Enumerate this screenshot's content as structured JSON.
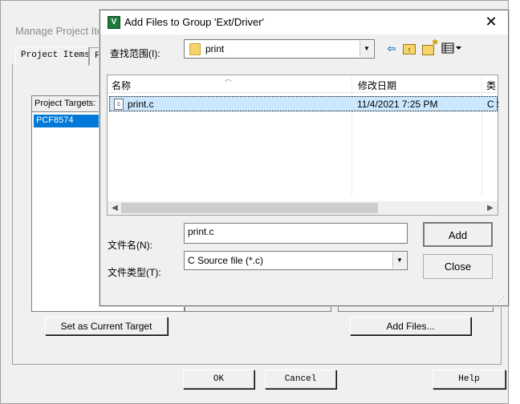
{
  "background_dialog": {
    "title": "Manage Project Ite",
    "tabs": [
      "Project Items",
      "Fo"
    ],
    "targets_header": "Project Targets:",
    "targets": [
      "PCF8574"
    ],
    "set_current_target_label": "Set as Current Target",
    "add_files_label": "Add Files...",
    "ok_label": "OK",
    "cancel_label": "Cancel",
    "help_label": "Help"
  },
  "add_files_dialog": {
    "title": "Add Files to Group 'Ext/Driver'",
    "app_icon": "V",
    "close_glyph": "✕",
    "lookin_label": "查找范围(I):",
    "lookin_value": "print",
    "toolbar_icons": [
      "back-icon",
      "up-folder-icon",
      "new-folder-icon",
      "view-menu-icon"
    ],
    "columns": {
      "name": "名称",
      "date": "修改日期",
      "type": "类"
    },
    "files": [
      {
        "name": "print.c",
        "modified": "11/4/2021 7:25 PM",
        "type": "C S",
        "selected": true
      }
    ],
    "filename_label": "文件名(N):",
    "filename_value": "print.c",
    "filetype_label": "文件类型(T):",
    "filetype_value": "C Source file (*.c)",
    "add_button_label": "Add",
    "close_button_label": "Close"
  }
}
